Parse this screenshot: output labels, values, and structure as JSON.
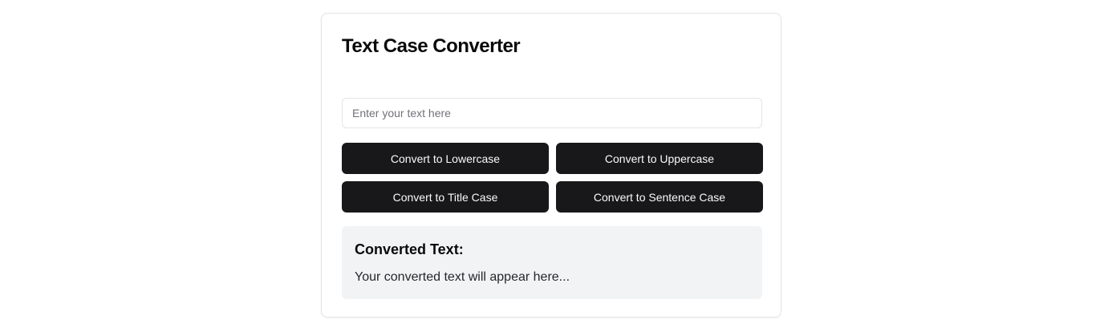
{
  "converter": {
    "title": "Text Case Converter",
    "input": {
      "placeholder": "Enter your text here",
      "value": ""
    },
    "buttons": {
      "lowercase": "Convert to Lowercase",
      "uppercase": "Convert to Uppercase",
      "title_case": "Convert to Title Case",
      "sentence_case": "Convert to Sentence Case"
    },
    "result": {
      "heading": "Converted Text:",
      "text": "Your converted text will appear here..."
    }
  },
  "colors": {
    "button_bg": "#18181b",
    "button_text": "#fafafa",
    "result_bg": "#f1f3f5",
    "border": "#e4e4e7"
  }
}
